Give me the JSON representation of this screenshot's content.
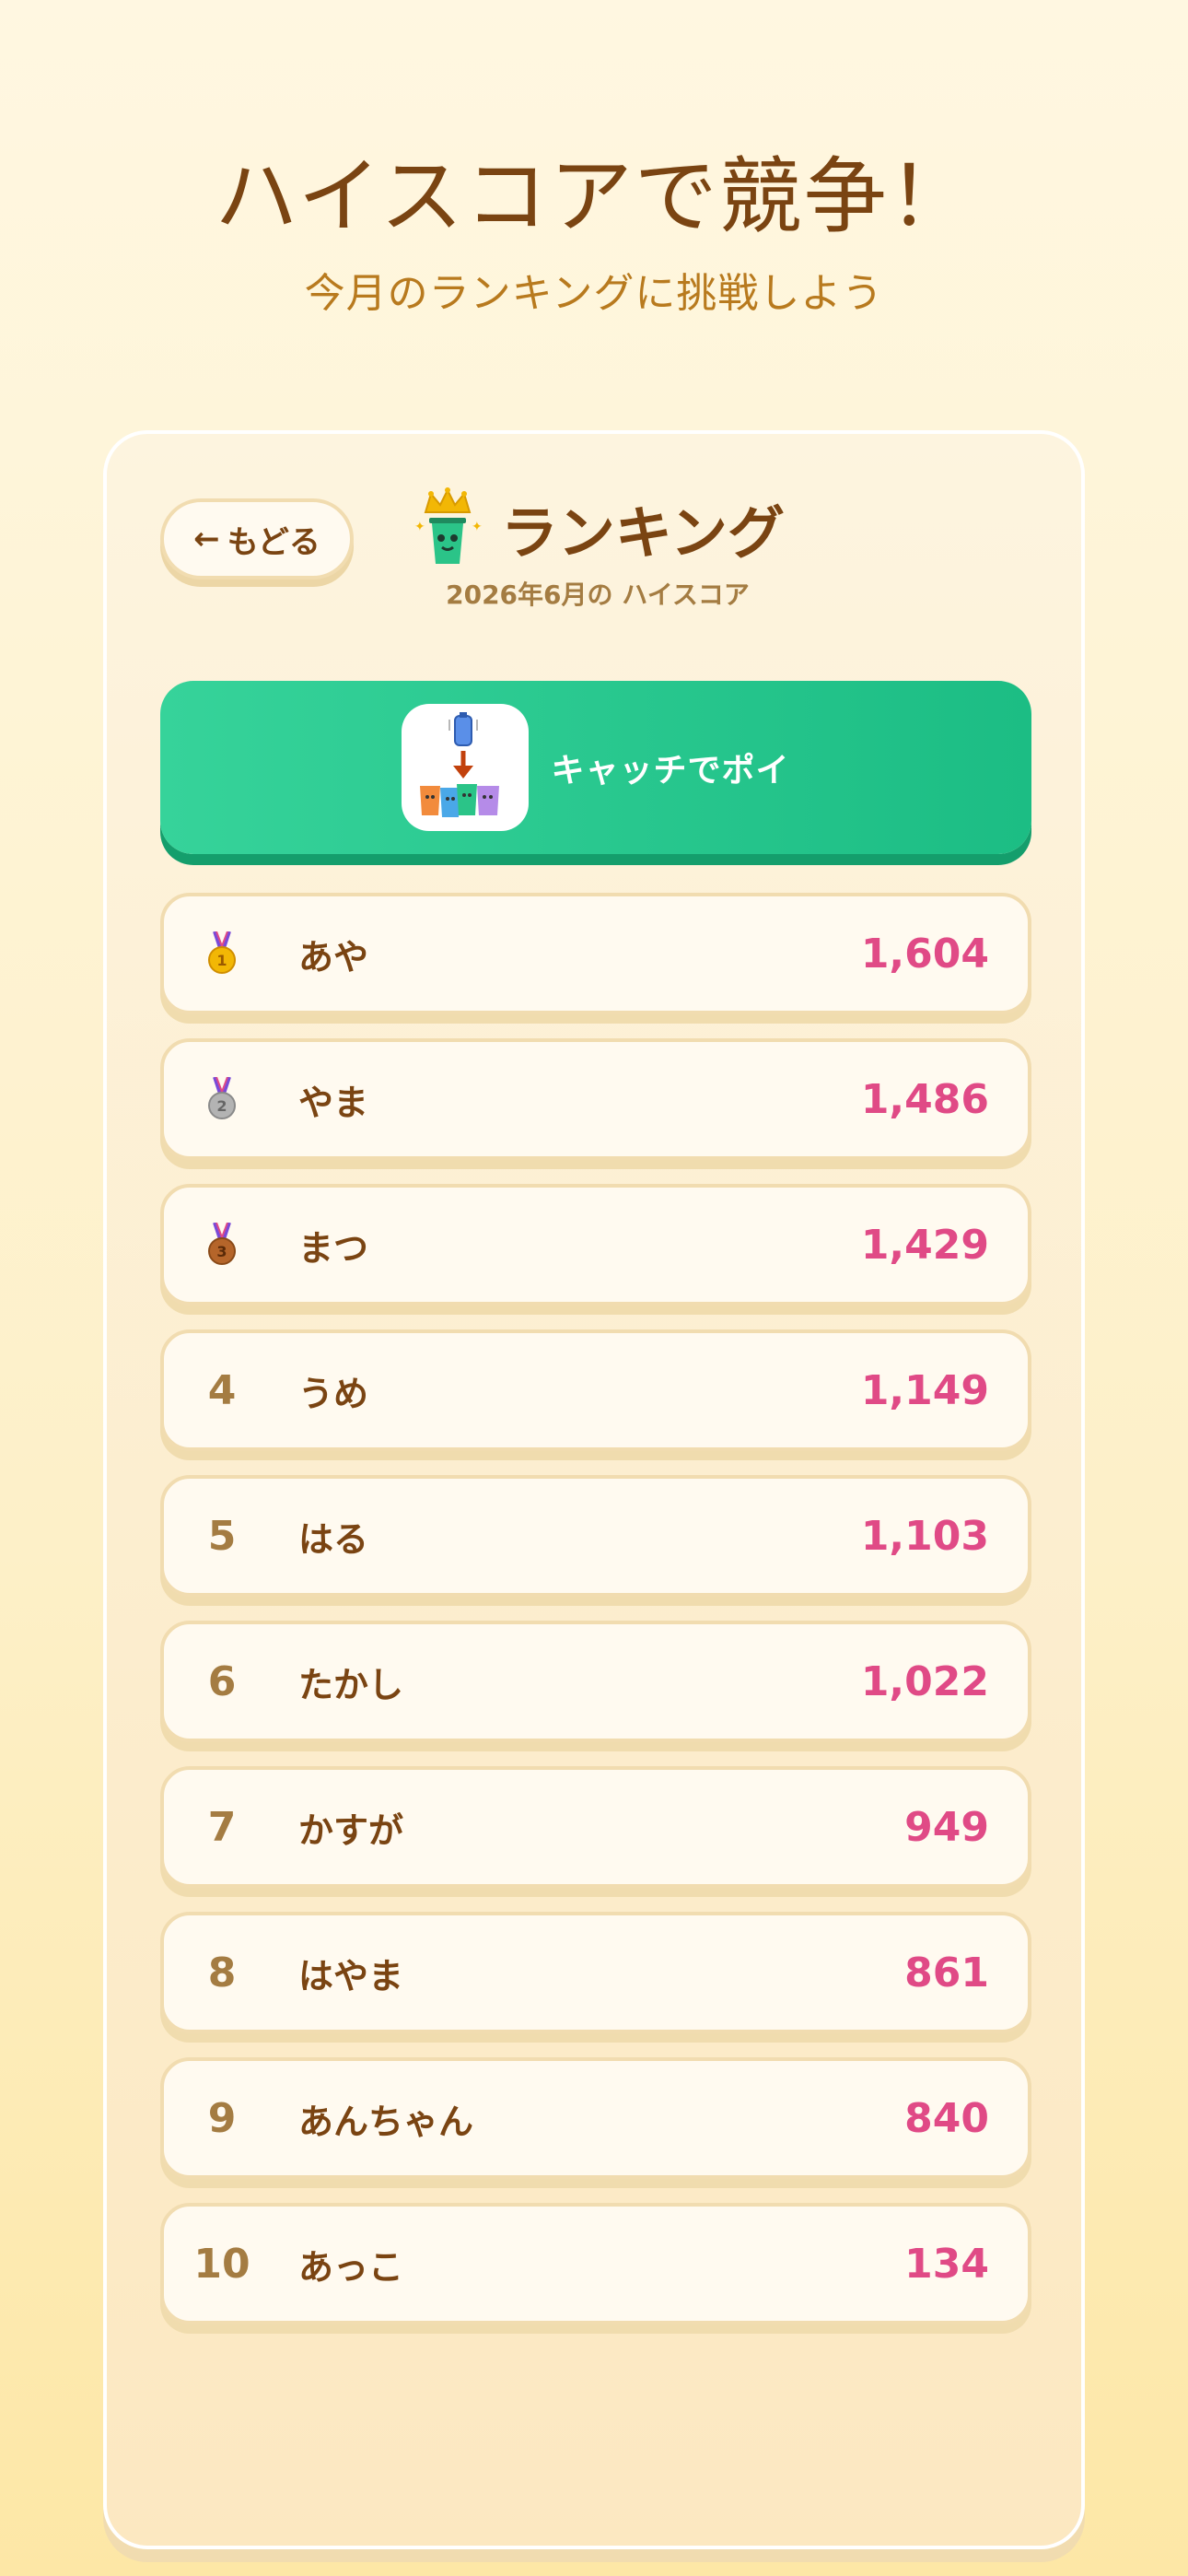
{
  "hero": {
    "title": "ハイスコアで競争！",
    "subtitle": "今月のランキングに挑戦しよう"
  },
  "header": {
    "back_label": "もどる",
    "back_icon": "arrow-left-icon",
    "title": "ランキング",
    "subtitle": "2026年6月の ハイスコア",
    "mascot_icon": "crowned-trash-can-mascot-icon"
  },
  "game": {
    "name": "キャッチでポイ",
    "icon": "catch-trash-game-icon"
  },
  "ranking": [
    {
      "rank": "1",
      "medal": "gold",
      "name": "あや",
      "score": "1,604"
    },
    {
      "rank": "2",
      "medal": "silver",
      "name": "やま",
      "score": "1,486"
    },
    {
      "rank": "3",
      "medal": "bronze",
      "name": "まつ",
      "score": "1,429"
    },
    {
      "rank": "4",
      "medal": "",
      "name": "うめ",
      "score": "1,149"
    },
    {
      "rank": "5",
      "medal": "",
      "name": "はる",
      "score": "1,103"
    },
    {
      "rank": "6",
      "medal": "",
      "name": "たかし",
      "score": "1,022"
    },
    {
      "rank": "7",
      "medal": "",
      "name": "かすが",
      "score": "949"
    },
    {
      "rank": "8",
      "medal": "",
      "name": "はやま",
      "score": "861"
    },
    {
      "rank": "9",
      "medal": "",
      "name": "あんちゃん",
      "score": "840"
    },
    {
      "rank": "10",
      "medal": "",
      "name": "あっこ",
      "score": "134"
    }
  ],
  "colors": {
    "accent_green": "#1cbd84",
    "score_pink": "#e04a86",
    "title_brown": "#7a4412",
    "gold": "#f2b705",
    "silver": "#a9a9a9",
    "bronze": "#b5652a"
  }
}
